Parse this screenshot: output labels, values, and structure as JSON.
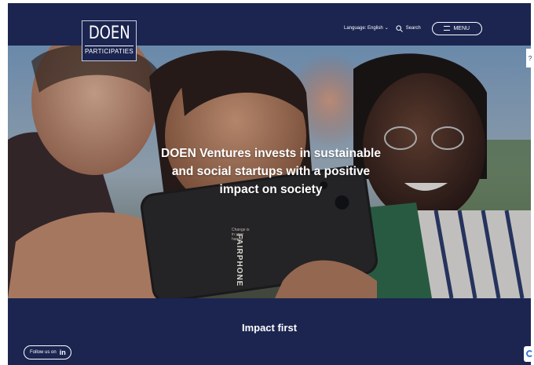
{
  "brand": {
    "logo_main": "DOEN",
    "logo_sub": "PARTICIPATIES"
  },
  "nav": {
    "language_label": "Language: English",
    "language_chevron": "⌄",
    "search_label": "Search",
    "search_icon": "search-icon",
    "menu_label": "MENU",
    "menu_icon": "hamburger-icon"
  },
  "hero": {
    "headline": "DOEN Ventures invests in sustainable and social startups with a positive impact on society",
    "phone_brand": "FAIRPHONE",
    "phone_tagline": "Change is in your hands"
  },
  "section": {
    "title": "Impact first"
  },
  "social": {
    "follow_label": "Follow us on",
    "linkedin_glyph": "in"
  },
  "colors": {
    "navy": "#1b2550",
    "white": "#ffffff"
  }
}
